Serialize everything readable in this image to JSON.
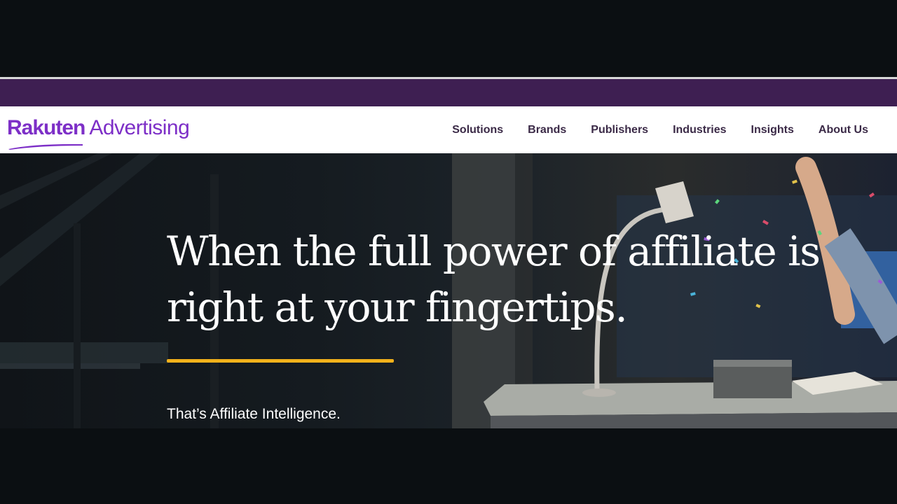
{
  "brand": {
    "logo_primary": "Rakuten",
    "logo_secondary": "Advertising",
    "color": "#7d2fc7"
  },
  "nav": {
    "items": [
      {
        "label": "Solutions"
      },
      {
        "label": "Brands"
      },
      {
        "label": "Publishers"
      },
      {
        "label": "Industries"
      },
      {
        "label": "Insights"
      },
      {
        "label": "About Us"
      }
    ],
    "text_color": "#3b2a47"
  },
  "promo_bar": {
    "color": "#3e1f52"
  },
  "hero": {
    "headline": "When the full power of affiliate is right at your fingertips.",
    "subheadline": "That’s Affiliate Intelligence.",
    "accent_color": "#f4b21b"
  }
}
